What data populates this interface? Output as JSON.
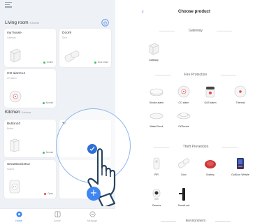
{
  "left_screen": {
    "rooms": [
      {
        "name": "Living room",
        "count": "5 devices",
        "devices": [
          {
            "name": "my house",
            "type": "Gateway",
            "status": "Online",
            "status_color": "#3cc46a"
          },
          {
            "name": "Door9",
            "type": "Door",
            "status": "Door close",
            "status_color": "#3cc46a"
          },
          {
            "name": "CO alarm14",
            "type": "CO alarm",
            "status": "Normal",
            "status_color": "#3cc46a"
          }
        ]
      },
      {
        "name": "Kitchen",
        "count": "5 devices",
        "devices": [
          {
            "name": "Button10",
            "type": "Button",
            "status": "Normal",
            "status_color": "#3cc46a"
          },
          {
            "name": "Th",
            "type": "",
            "status": "",
            "status_color": "#3cc46a"
          },
          {
            "name": "SmartSocket12",
            "type": "Socket",
            "status": "Open",
            "status_color": "#e64a4a"
          }
        ]
      }
    ],
    "tabs": [
      {
        "label": "Home",
        "icon": "home-icon",
        "active": true
      },
      {
        "label": "Scene",
        "icon": "scene-icon",
        "active": false
      },
      {
        "label": "Message",
        "icon": "message-icon",
        "active": false
      }
    ],
    "fab_label": "+",
    "accent": "#3f86f2"
  },
  "right_screen": {
    "title": "Choose product",
    "back_glyph": "‹",
    "sections": [
      {
        "title": "Gateway",
        "products": [
          "Gateway"
        ]
      },
      {
        "title": "Fire Protection",
        "products": [
          "Smoke alarm",
          "CO alarm",
          "GAS alarm",
          "Thermal",
          "WaterCheck",
          "CKSmoke"
        ]
      },
      {
        "title": "Theft Prevention",
        "products": [
          "PIR",
          "Door",
          "Sosbey",
          "OutDoor Whistle",
          "Camera",
          "SmartLock"
        ]
      },
      {
        "title": "Environment",
        "products": []
      }
    ]
  }
}
